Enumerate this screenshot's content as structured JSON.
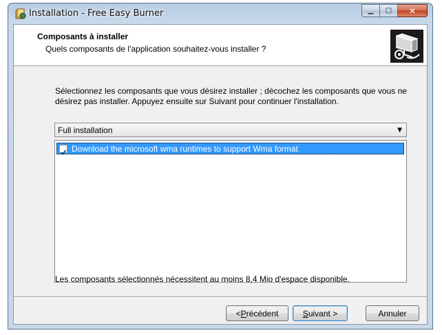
{
  "window": {
    "title": "Installation - Free Easy Burner",
    "minimize_glyph": "▁",
    "maximize_glyph": "□",
    "close_glyph": "✕"
  },
  "header": {
    "title": "Composants à installer",
    "subtitle": "Quels composants de l'application souhaitez-vous installer ?"
  },
  "body": {
    "instructions": "Sélectionnez les composants que vous désirez installer ; décochez les composants que vous ne désirez pas installer. Appuyez ensuite sur Suivant pour continuer l'installation.",
    "setup_type": {
      "selected": "Full installation",
      "arrow": "▼"
    },
    "components": [
      {
        "label": "Download the microsoft wma runtimes to support Wma format",
        "checked": true,
        "selected": true
      }
    ],
    "space_required": "Les composants sélectionnés nécessitent au moins 8,4 Mio d'espace disponible."
  },
  "buttons": {
    "back_prefix": "< ",
    "back_accel": "P",
    "back_rest": "récédent",
    "next_accel": "S",
    "next_rest": "uivant >",
    "cancel": "Annuler"
  },
  "colors": {
    "selection": "#3399ff",
    "dialog_bg": "#f0f0f0",
    "frame": "#c8d8e8"
  }
}
